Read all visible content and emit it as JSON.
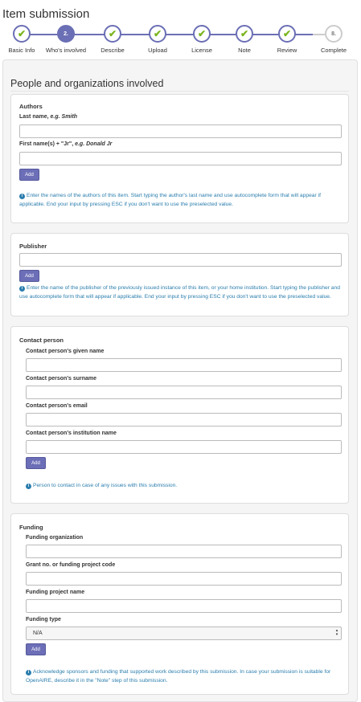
{
  "page_title": "Item submission",
  "steps": [
    {
      "label": "Basic Info",
      "state": "done"
    },
    {
      "label": "Who's involved",
      "state": "active",
      "number": "2."
    },
    {
      "label": "Describe",
      "state": "done"
    },
    {
      "label": "Upload",
      "state": "done"
    },
    {
      "label": "License",
      "state": "done"
    },
    {
      "label": "Note",
      "state": "done"
    },
    {
      "label": "Review",
      "state": "done"
    },
    {
      "label": "Complete",
      "state": "todo",
      "number": "8."
    }
  ],
  "section_title": "People and organizations involved",
  "authors": {
    "header": "Authors",
    "last_name_label": "Last name, ",
    "last_name_example": "e.g. Smith",
    "first_name_label": "First name(s) + \"Jr\", ",
    "first_name_example": "e.g. Donald Jr",
    "add_label": "Add",
    "help": "Enter the names of the authors of this item. Start typing the author's last name and use autocomplete form that will appear if applicable. End your input by pressing ESC if you don't want to use the preselected value."
  },
  "publisher": {
    "header": "Publisher",
    "add_label": "Add",
    "help": "Enter the name of the publisher of the previously issued instance of this item, or your home institution. Start typing the publisher and use autocomplete form that will appear if applicable. End your input by pressing ESC if you don't want to use the preselected value."
  },
  "contact": {
    "header": "Contact person",
    "given_name_label": "Contact person's given name",
    "surname_label": "Contact person's surname",
    "email_label": "Contact person's email",
    "institution_label": "Contact person's institution name",
    "add_label": "Add",
    "help": "Person to contact in case of any issues with this submission."
  },
  "funding": {
    "header": "Funding",
    "org_label": "Funding organization",
    "grant_label": "Grant no. or funding project code",
    "project_label": "Funding project name",
    "type_label": "Funding type",
    "type_value": "N/A",
    "add_label": "Add",
    "help": "Acknowledge sponsors and funding that supported work described by this submission. In case your submission is suitable for OpenAIRE, describe it in the \"Note\" step of this submission."
  },
  "colors": {
    "accent": "#6b6fb5",
    "check": "#7ab51d",
    "help_text": "#2a7dad",
    "pending": "#cccccc"
  }
}
